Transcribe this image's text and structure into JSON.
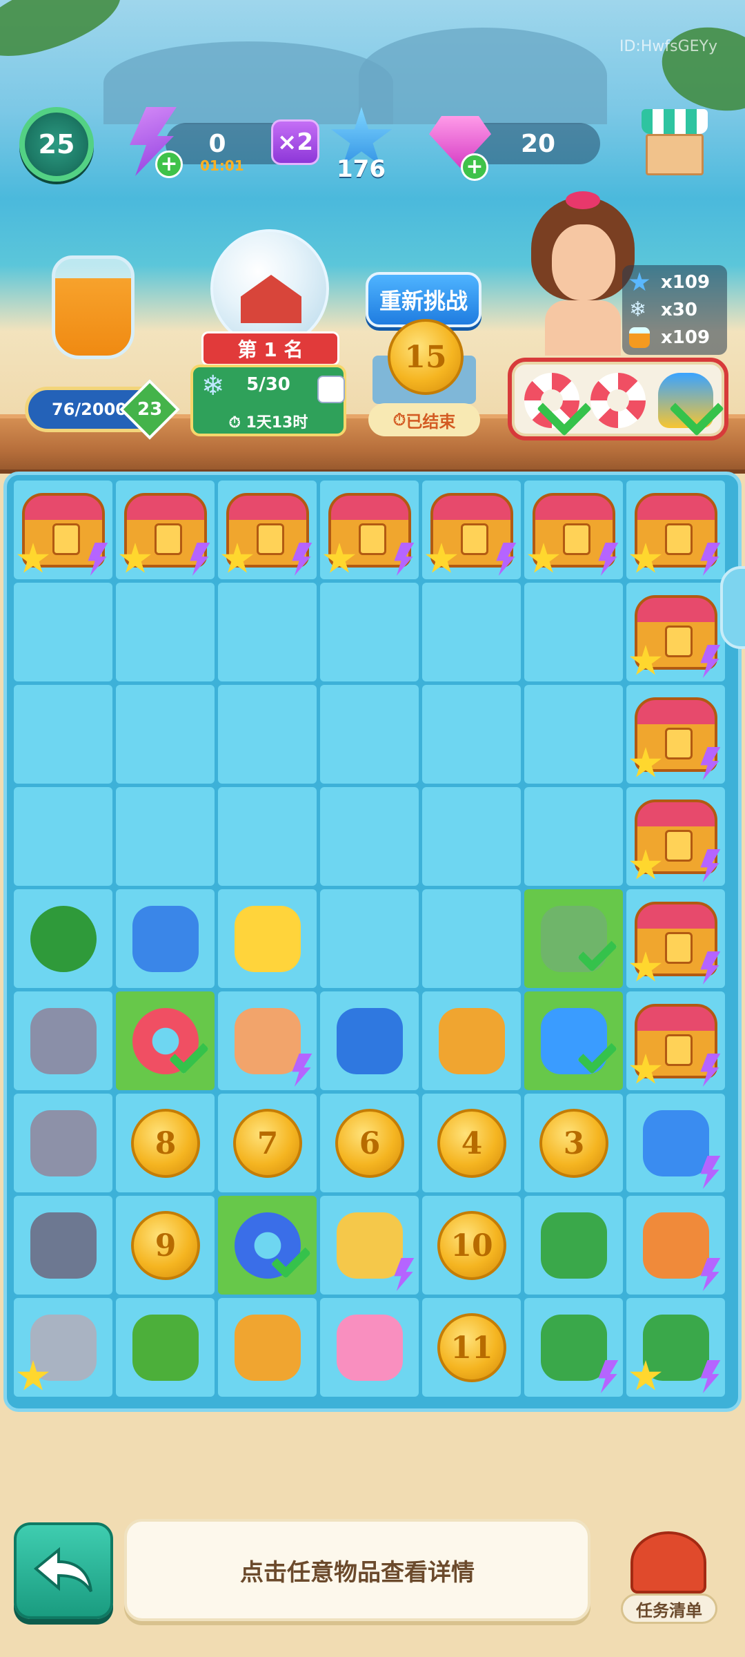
{
  "watermark": "ID:HwfsGEYy",
  "top_bar": {
    "level": "25",
    "energy_value": "0",
    "energy_timer": "01:01",
    "multiplier": "×2",
    "stars": "176",
    "gems": "20"
  },
  "event": {
    "jar_progress": "76/2000",
    "jar_level": "23",
    "rank_label": "第 1 名",
    "snow_progress": "5/30",
    "time_left": "1天13时",
    "retry_label": "重新挑战",
    "coin_value": "15",
    "ended_label": "已结束",
    "rewards": [
      {
        "icon": "star-icon",
        "amount": "x109"
      },
      {
        "icon": "snowflake-icon",
        "amount": "x30"
      },
      {
        "icon": "juice-icon",
        "amount": "x109"
      }
    ]
  },
  "board": {
    "coins": {
      "r6c1": "8",
      "r6c2": "7",
      "r6c3": "6",
      "r6c4": "4",
      "r6c5": "3",
      "r7c1": "9",
      "r7c4": "10",
      "r8c4": "11"
    }
  },
  "bottom": {
    "hint": "点击任意物品查看详情",
    "tasks_label": "任务清单"
  },
  "colors": {
    "board": "#3db1d8",
    "cell": "#6ed6f1",
    "cell_selected": "#67c84a",
    "check": "#35c24b"
  }
}
